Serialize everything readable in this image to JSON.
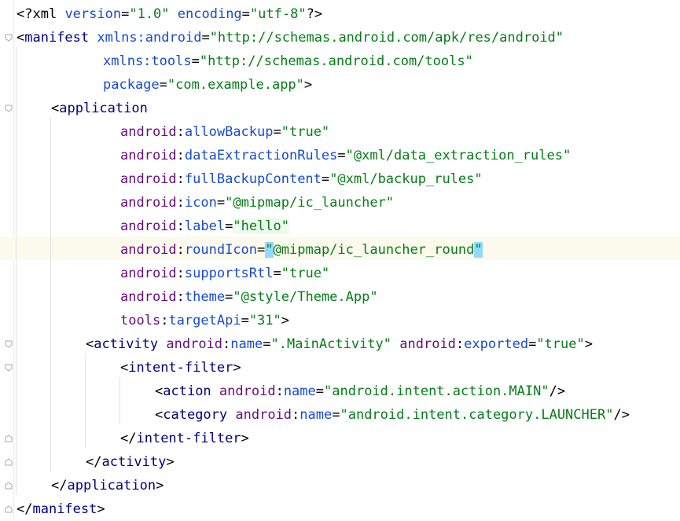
{
  "editor": {
    "lines": [
      {
        "indent": 1,
        "fold": "none",
        "tokens": [
          {
            "k": "punc",
            "t": "<?"
          },
          {
            "k": "prolog",
            "t": "xml "
          },
          {
            "k": "attr",
            "t": "version"
          },
          {
            "k": "eq",
            "t": "="
          },
          {
            "k": "val",
            "t": "\"1.0\""
          },
          {
            "k": "punc",
            "t": " "
          },
          {
            "k": "attr",
            "t": "encoding"
          },
          {
            "k": "eq",
            "t": "="
          },
          {
            "k": "val",
            "t": "\"utf-8\""
          },
          {
            "k": "punc",
            "t": "?>"
          }
        ]
      },
      {
        "indent": 1,
        "fold": "open",
        "tokens": [
          {
            "k": "punc",
            "t": "<"
          },
          {
            "k": "tag",
            "t": "manifest "
          },
          {
            "k": "attr",
            "t": "xmlns:android"
          },
          {
            "k": "eq",
            "t": "="
          },
          {
            "k": "val",
            "t": "\"http://schemas.android.com/apk/res/android\""
          }
        ]
      },
      {
        "indent": 11,
        "fold": "none",
        "tokens": [
          {
            "k": "attr",
            "t": "xmlns:tools"
          },
          {
            "k": "eq",
            "t": "="
          },
          {
            "k": "val",
            "t": "\"http://schemas.android.com/tools\""
          }
        ]
      },
      {
        "indent": 11,
        "fold": "none",
        "tokens": [
          {
            "k": "attr",
            "t": "package"
          },
          {
            "k": "eq",
            "t": "="
          },
          {
            "k": "val",
            "t": "\"com.example.app\""
          },
          {
            "k": "punc",
            "t": ">"
          }
        ]
      },
      {
        "indent": 5,
        "fold": "open",
        "tokens": [
          {
            "k": "punc",
            "t": "<"
          },
          {
            "k": "tag",
            "t": "application"
          }
        ]
      },
      {
        "indent": 13,
        "fold": "none",
        "tokens": [
          {
            "k": "ns",
            "t": "android"
          },
          {
            "k": "punc",
            "t": ":"
          },
          {
            "k": "attr",
            "t": "allowBackup"
          },
          {
            "k": "eq",
            "t": "="
          },
          {
            "k": "val",
            "t": "\"true\""
          }
        ]
      },
      {
        "indent": 13,
        "fold": "none",
        "tokens": [
          {
            "k": "ns",
            "t": "android"
          },
          {
            "k": "punc",
            "t": ":"
          },
          {
            "k": "attr",
            "t": "dataExtractionRules"
          },
          {
            "k": "eq",
            "t": "="
          },
          {
            "k": "val",
            "t": "\"@xml/data_extraction_rules\""
          }
        ]
      },
      {
        "indent": 13,
        "fold": "none",
        "tokens": [
          {
            "k": "ns",
            "t": "android"
          },
          {
            "k": "punc",
            "t": ":"
          },
          {
            "k": "attr",
            "t": "fullBackupContent"
          },
          {
            "k": "eq",
            "t": "="
          },
          {
            "k": "val",
            "t": "\"@xml/backup_rules\""
          }
        ]
      },
      {
        "indent": 13,
        "fold": "none",
        "tokens": [
          {
            "k": "ns",
            "t": "android"
          },
          {
            "k": "punc",
            "t": ":"
          },
          {
            "k": "attr",
            "t": "icon"
          },
          {
            "k": "eq",
            "t": "="
          },
          {
            "k": "val",
            "t": "\"@mipmap/ic_launcher\""
          }
        ]
      },
      {
        "indent": 13,
        "fold": "none",
        "tokens": [
          {
            "k": "ns",
            "t": "android"
          },
          {
            "k": "punc",
            "t": ":"
          },
          {
            "k": "attr",
            "t": "label"
          },
          {
            "k": "eq",
            "t": "="
          },
          {
            "k": "val",
            "t": "\"hello\"",
            "hl": "val"
          }
        ]
      },
      {
        "indent": 13,
        "fold": "none",
        "tokens": [
          {
            "k": "ns",
            "t": "android"
          },
          {
            "k": "punc",
            "t": ":"
          },
          {
            "k": "attr",
            "t": "roundIcon"
          },
          {
            "k": "eq",
            "t": "="
          },
          {
            "k": "val",
            "t": "\"",
            "hl": "q"
          },
          {
            "k": "val",
            "t": "@mipmap/ic_launcher_round"
          },
          {
            "k": "val",
            "t": "\"",
            "hl": "q"
          }
        ]
      },
      {
        "indent": 13,
        "fold": "none",
        "tokens": [
          {
            "k": "ns",
            "t": "android"
          },
          {
            "k": "punc",
            "t": ":"
          },
          {
            "k": "attr",
            "t": "supportsRtl"
          },
          {
            "k": "eq",
            "t": "="
          },
          {
            "k": "val",
            "t": "\"true\""
          }
        ]
      },
      {
        "indent": 13,
        "fold": "none",
        "tokens": [
          {
            "k": "ns",
            "t": "android"
          },
          {
            "k": "punc",
            "t": ":"
          },
          {
            "k": "attr",
            "t": "theme"
          },
          {
            "k": "eq",
            "t": "="
          },
          {
            "k": "val",
            "t": "\"@style/Theme.App\""
          }
        ]
      },
      {
        "indent": 13,
        "fold": "none",
        "tokens": [
          {
            "k": "ns",
            "t": "tools"
          },
          {
            "k": "punc",
            "t": ":"
          },
          {
            "k": "attr",
            "t": "targetApi"
          },
          {
            "k": "eq",
            "t": "="
          },
          {
            "k": "val",
            "t": "\"31\""
          },
          {
            "k": "punc",
            "t": ">"
          }
        ]
      },
      {
        "indent": 9,
        "fold": "open",
        "tokens": [
          {
            "k": "punc",
            "t": "<"
          },
          {
            "k": "tag",
            "t": "activity "
          },
          {
            "k": "ns",
            "t": "android"
          },
          {
            "k": "punc",
            "t": ":"
          },
          {
            "k": "attr",
            "t": "name"
          },
          {
            "k": "eq",
            "t": "="
          },
          {
            "k": "val",
            "t": "\".MainActivity\""
          },
          {
            "k": "punc",
            "t": " "
          },
          {
            "k": "ns",
            "t": "android"
          },
          {
            "k": "punc",
            "t": ":"
          },
          {
            "k": "attr",
            "t": "exported"
          },
          {
            "k": "eq",
            "t": "="
          },
          {
            "k": "val",
            "t": "\"true\""
          },
          {
            "k": "punc",
            "t": ">"
          }
        ]
      },
      {
        "indent": 13,
        "fold": "open",
        "tokens": [
          {
            "k": "punc",
            "t": "<"
          },
          {
            "k": "tag",
            "t": "intent-filter"
          },
          {
            "k": "punc",
            "t": ">"
          }
        ]
      },
      {
        "indent": 17,
        "fold": "none",
        "tokens": [
          {
            "k": "punc",
            "t": "<"
          },
          {
            "k": "tag",
            "t": "action "
          },
          {
            "k": "ns",
            "t": "android"
          },
          {
            "k": "punc",
            "t": ":"
          },
          {
            "k": "attr",
            "t": "name"
          },
          {
            "k": "eq",
            "t": "="
          },
          {
            "k": "val",
            "t": "\"android.intent.action.MAIN\""
          },
          {
            "k": "punc",
            "t": "/>"
          }
        ]
      },
      {
        "indent": 17,
        "fold": "none",
        "tokens": [
          {
            "k": "punc",
            "t": "<"
          },
          {
            "k": "tag",
            "t": "category "
          },
          {
            "k": "ns",
            "t": "android"
          },
          {
            "k": "punc",
            "t": ":"
          },
          {
            "k": "attr",
            "t": "name"
          },
          {
            "k": "eq",
            "t": "="
          },
          {
            "k": "val",
            "t": "\"android.intent.category.LAUNCHER\""
          },
          {
            "k": "punc",
            "t": "/>"
          }
        ]
      },
      {
        "indent": 13,
        "fold": "close",
        "tokens": [
          {
            "k": "punc",
            "t": "</"
          },
          {
            "k": "tag",
            "t": "intent-filter"
          },
          {
            "k": "punc",
            "t": ">"
          }
        ]
      },
      {
        "indent": 9,
        "fold": "close",
        "tokens": [
          {
            "k": "punc",
            "t": "</"
          },
          {
            "k": "tag",
            "t": "activity"
          },
          {
            "k": "punc",
            "t": ">"
          }
        ]
      },
      {
        "indent": 5,
        "fold": "close",
        "tokens": [
          {
            "k": "punc",
            "t": "</"
          },
          {
            "k": "tag",
            "t": "application"
          },
          {
            "k": "punc",
            "t": ">"
          }
        ]
      },
      {
        "indent": 1,
        "fold": "close",
        "tokens": [
          {
            "k": "punc",
            "t": "</"
          },
          {
            "k": "tag",
            "t": "manifest"
          },
          {
            "k": "punc",
            "t": ">"
          }
        ]
      }
    ]
  }
}
